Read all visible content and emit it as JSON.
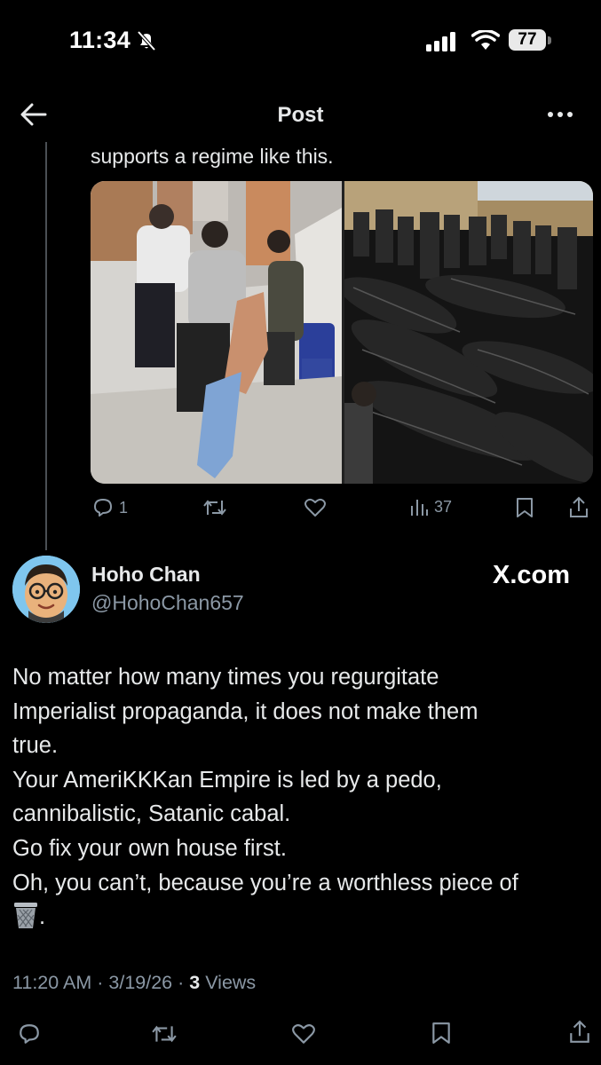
{
  "status_bar": {
    "time": "11:34",
    "battery": "77"
  },
  "header": {
    "title": "Post"
  },
  "quoted_post": {
    "text": "supports a regime like this.",
    "stats": {
      "replies": "1",
      "views": "37"
    }
  },
  "author": {
    "name": "Hoho Chan",
    "handle": "@HohoChan657",
    "source": "X.com"
  },
  "post": {
    "lines": [
      "No matter how many times you regurgitate",
      "Imperialist propaganda, it does not make them",
      "true.",
      "Your AmeriKKKan Empire is led by a pedo,",
      "cannibalistic, Satanic cabal.",
      "Go fix your own house first.",
      "Oh, you can’t, because you’re a worthless piece of"
    ],
    "trailing_emoji": "wastebasket-icon",
    "trailing_text": "."
  },
  "meta": {
    "time": "11:20 AM",
    "date": "3/19/26",
    "views_count": "3",
    "views_label": "Views",
    "separator": "·"
  },
  "colors": {
    "background": "#000000",
    "text": "#e7e9ea",
    "secondary": "#8b98a5",
    "thread_line": "#4a4f54"
  }
}
